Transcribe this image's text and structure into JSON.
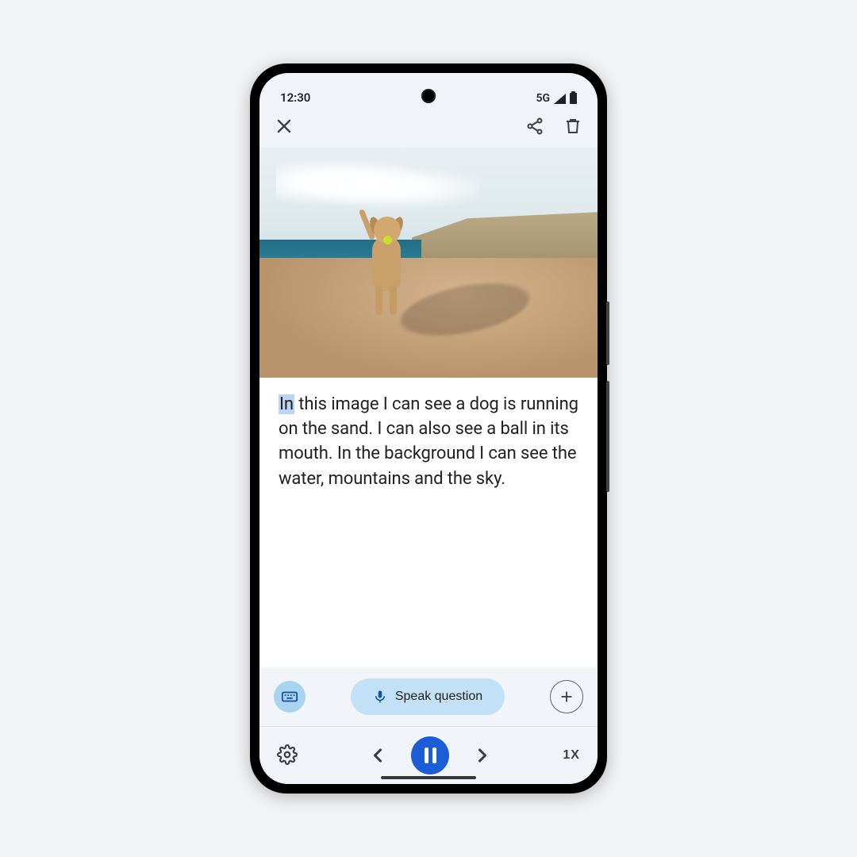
{
  "status": {
    "time": "12:30",
    "network": "5G"
  },
  "caption": {
    "highlight": "In",
    "rest": " this image I can see a dog is running on the sand. I can also see a ball in its mouth. In the background I can see the water, mountains and the sky."
  },
  "input": {
    "speak_label": "Speak question"
  },
  "playback": {
    "speed_label": "1X"
  }
}
